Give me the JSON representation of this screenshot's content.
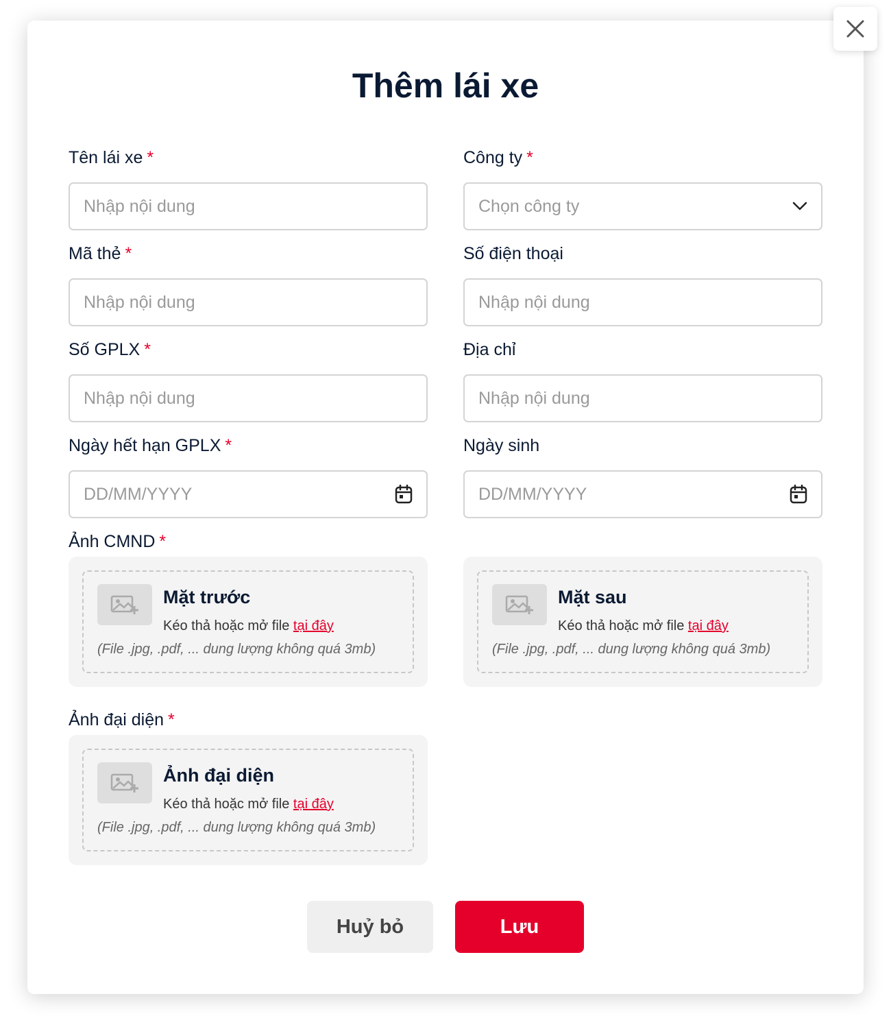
{
  "modal": {
    "title": "Thêm lái xe",
    "required_mark": "*"
  },
  "fields": {
    "driver_name": {
      "label": "Tên lái xe",
      "placeholder": "Nhập nội dung"
    },
    "company": {
      "label": "Công ty",
      "placeholder": "Chọn công ty"
    },
    "card_code": {
      "label": "Mã thẻ",
      "placeholder": "Nhập nội dung"
    },
    "phone": {
      "label": "Số điện thoại",
      "placeholder": "Nhập nội dung"
    },
    "license_no": {
      "label": "Số GPLX",
      "placeholder": "Nhập nội dung"
    },
    "address": {
      "label": "Địa chỉ",
      "placeholder": "Nhập nội dung"
    },
    "license_expiry": {
      "label": "Ngày hết hạn GPLX",
      "placeholder": "DD/MM/YYYY"
    },
    "birthday": {
      "label": "Ngày sinh",
      "placeholder": "DD/MM/YYYY"
    }
  },
  "id_photos": {
    "label": "Ảnh CMND",
    "front": {
      "title": "Mặt trước",
      "desc": "Kéo thả hoặc mở file",
      "link": "tại đây",
      "hint": "(File .jpg, .pdf, ... dung lượng không quá 3mb)"
    },
    "back": {
      "title": "Mặt sau",
      "desc": "Kéo thả hoặc mở file",
      "link": "tại đây",
      "hint": "(File .jpg, .pdf, ... dung lượng không quá 3mb)"
    }
  },
  "avatar": {
    "label": "Ảnh đại diện",
    "title": "Ảnh đại diện",
    "desc": "Kéo thả hoặc mở file",
    "link": "tại đây",
    "hint": "(File .jpg, .pdf, ... dung lượng không quá 3mb)"
  },
  "buttons": {
    "cancel": "Huỷ bỏ",
    "save": "Lưu"
  },
  "icons": {
    "close": "close-icon",
    "dropdown": "chevron-down-icon",
    "calendar": "calendar-icon",
    "image_upload": "image-add-icon"
  },
  "colors": {
    "accent": "#e5002b",
    "title": "#0b1a33",
    "placeholder": "#9a9a9a"
  }
}
